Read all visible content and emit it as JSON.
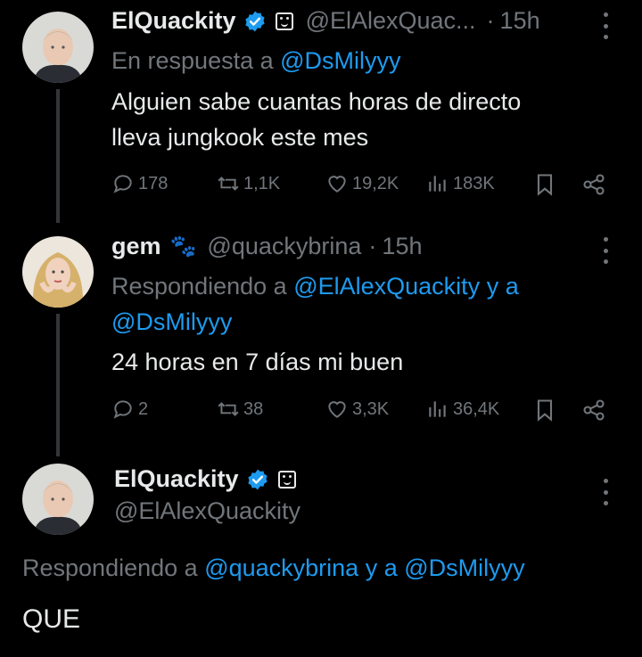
{
  "tweets": [
    {
      "name": "ElQuackity",
      "handle": "@ElAlexQuac...",
      "time": "15h",
      "time_sep": "·",
      "reply_prefix": "En respuesta a",
      "reply_user1": "@DsMilyyy",
      "text_line1": "Alguien sabe cuantas horas de directo",
      "text_line2": "lleva jungkook este mes",
      "replies": "178",
      "reposts": "1,1K",
      "likes": "19,2K",
      "views": "183K"
    },
    {
      "name": "gem",
      "emoji": "🐾",
      "handle": "@quackybrina",
      "time": "15h",
      "time_sep": "·",
      "reply_prefix": "Respondiendo a",
      "reply_user1": "@ElAlexQuackity",
      "reply_and": "y a",
      "reply_user2": "@DsMilyyy",
      "text_line1": "24 horas en 7 días mi buen",
      "replies": "2",
      "reposts": "38",
      "likes": "3,3K",
      "views": "36,4K"
    },
    {
      "name": "ElQuackity",
      "handle": "@ElAlexQuackity",
      "reply_prefix": "Respondiendo a",
      "reply_user1": "@quackybrina",
      "reply_and": "y a",
      "reply_user2": "@DsMilyyy",
      "text_line1": "QUE"
    }
  ],
  "colors": {
    "background": "#000000",
    "text": "#e7e9ea",
    "muted": "#71767b",
    "link": "#1d9bf0",
    "thread_line": "#333639"
  },
  "icons": [
    "reply-icon",
    "repost-icon",
    "like-icon",
    "views-icon",
    "bookmark-icon",
    "share-icon",
    "verified-icon",
    "affiliate-icon",
    "more-icon"
  ]
}
